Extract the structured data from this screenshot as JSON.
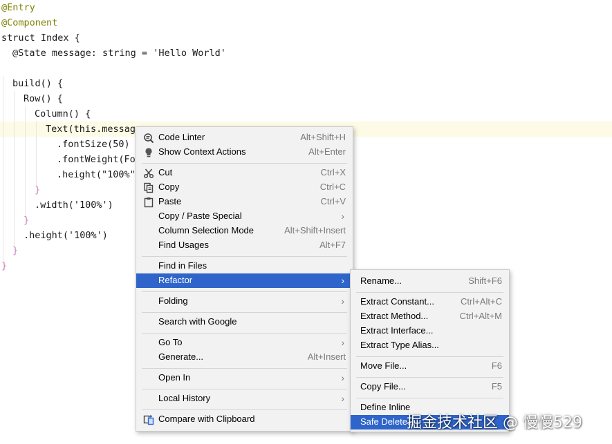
{
  "editor": {
    "lines": [
      "@Entry",
      "@Component",
      "struct Index {",
      "@State message: string = 'Hello World'",
      "build() {",
      "Row() {",
      "Column() {",
      "Text(this.messag",
      ".fontSize(50)",
      ".fontWeight(Fo",
      ".height(\"100%\"",
      "}",
      ".width('100%')",
      "}",
      ".height('100%')",
      "}",
      "}"
    ]
  },
  "context_menu": {
    "items": [
      {
        "label": "Code Linter",
        "shortcut": "Alt+Shift+H",
        "icon": "code-linter-icon"
      },
      {
        "label": "Show Context Actions",
        "shortcut": "Alt+Enter",
        "icon": "lightbulb-icon"
      },
      {
        "label": "Cut",
        "shortcut": "Ctrl+X",
        "icon": "scissors-icon"
      },
      {
        "label": "Copy",
        "shortcut": "Ctrl+C",
        "icon": "copy-icon"
      },
      {
        "label": "Paste",
        "shortcut": "Ctrl+V",
        "icon": "clipboard-icon"
      },
      {
        "label": "Copy / Paste Special",
        "shortcut": "",
        "icon": ""
      },
      {
        "label": "Column Selection Mode",
        "shortcut": "Alt+Shift+Insert",
        "icon": ""
      },
      {
        "label": "Find Usages",
        "shortcut": "Alt+F7",
        "icon": ""
      },
      {
        "label": "Find in Files",
        "shortcut": "",
        "icon": ""
      },
      {
        "label": "Refactor",
        "shortcut": "",
        "icon": ""
      },
      {
        "label": "Folding",
        "shortcut": "",
        "icon": ""
      },
      {
        "label": "Search with Google",
        "shortcut": "",
        "icon": ""
      },
      {
        "label": "Go To",
        "shortcut": "",
        "icon": ""
      },
      {
        "label": "Generate...",
        "shortcut": "Alt+Insert",
        "icon": ""
      },
      {
        "label": "Open In",
        "shortcut": "",
        "icon": ""
      },
      {
        "label": "Local History",
        "shortcut": "",
        "icon": ""
      },
      {
        "label": "Compare with Clipboard",
        "shortcut": "",
        "icon": "compare-icon"
      }
    ]
  },
  "refactor_submenu": {
    "items": [
      {
        "label": "Rename...",
        "shortcut": "Shift+F6"
      },
      {
        "label": "Extract Constant...",
        "shortcut": "Ctrl+Alt+C"
      },
      {
        "label": "Extract Method...",
        "shortcut": "Ctrl+Alt+M"
      },
      {
        "label": "Extract Interface...",
        "shortcut": ""
      },
      {
        "label": "Extract Type Alias...",
        "shortcut": ""
      },
      {
        "label": "Move File...",
        "shortcut": "F6"
      },
      {
        "label": "Copy File...",
        "shortcut": "F5"
      },
      {
        "label": "Define Inline",
        "shortcut": ""
      },
      {
        "label": "Safe Delete...",
        "shortcut": ""
      }
    ]
  },
  "watermark": "掘金技术社区 @ 慢慢529",
  "colors": {
    "menu_highlight": "#2f65ca",
    "menu_bg": "#f2f2f2",
    "selection": "#a6d2ff"
  }
}
